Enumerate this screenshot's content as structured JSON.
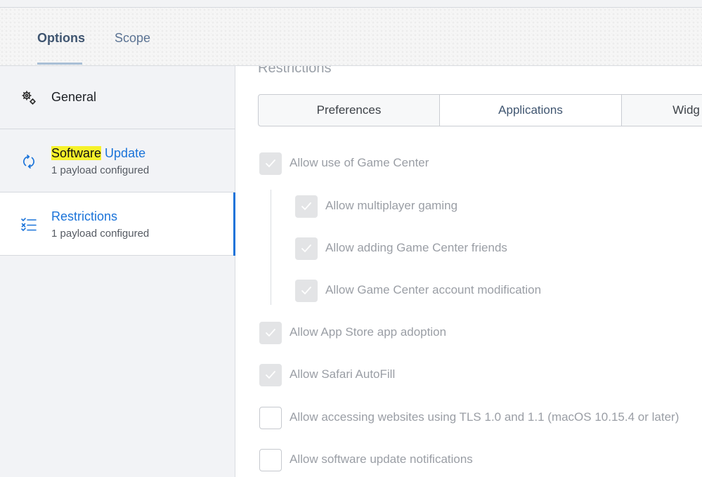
{
  "tabs": {
    "options": "Options",
    "scope": "Scope"
  },
  "sidebar": {
    "items": [
      {
        "title": "General",
        "icon": "gears-icon"
      },
      {
        "title_highlight": "Software",
        "title_rest": " Update",
        "subtitle": "1 payload configured",
        "icon": "sync-icon"
      },
      {
        "title": "Restrictions",
        "subtitle": "1 payload configured",
        "icon": "checklist-icon"
      }
    ]
  },
  "main": {
    "section_title": "Restrictions",
    "segments": [
      "Preferences",
      "Applications",
      "Widg"
    ],
    "options": [
      {
        "label": "Allow use of Game Center",
        "checked": true
      },
      {
        "label": "Allow multiplayer gaming",
        "checked": true
      },
      {
        "label": "Allow adding Game Center friends",
        "checked": true
      },
      {
        "label": "Allow Game Center account modification",
        "checked": true
      },
      {
        "label": "Allow App Store app adoption",
        "checked": true
      },
      {
        "label": "Allow Safari AutoFill",
        "checked": true
      },
      {
        "label": "Allow accessing websites using TLS 1.0 and 1.1 (macOS 10.15.4 or later)",
        "checked": false
      },
      {
        "label": "Allow software update notifications",
        "checked": false
      }
    ]
  },
  "colors": {
    "accent": "#1a73d9",
    "highlight": "#f7f22a",
    "muted_text": "#9a9ea5"
  }
}
